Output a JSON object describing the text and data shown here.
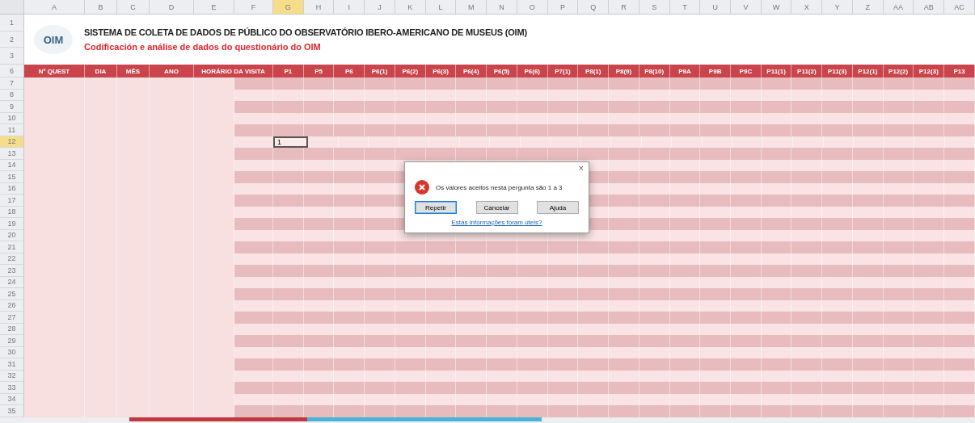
{
  "columns": [
    {
      "letter": "A",
      "selected": false
    },
    {
      "letter": "B",
      "selected": false
    },
    {
      "letter": "C",
      "selected": false
    },
    {
      "letter": "D",
      "selected": false
    },
    {
      "letter": "E",
      "selected": false
    },
    {
      "letter": "F",
      "selected": false
    },
    {
      "letter": "G",
      "selected": true
    },
    {
      "letter": "H",
      "selected": false
    },
    {
      "letter": "I",
      "selected": false
    },
    {
      "letter": "J",
      "selected": false
    },
    {
      "letter": "K",
      "selected": false
    },
    {
      "letter": "L",
      "selected": false
    },
    {
      "letter": "M",
      "selected": false
    },
    {
      "letter": "N",
      "selected": false
    },
    {
      "letter": "O",
      "selected": false
    },
    {
      "letter": "P",
      "selected": false
    },
    {
      "letter": "Q",
      "selected": false
    },
    {
      "letter": "R",
      "selected": false
    },
    {
      "letter": "S",
      "selected": false
    },
    {
      "letter": "T",
      "selected": false
    },
    {
      "letter": "U",
      "selected": false
    },
    {
      "letter": "V",
      "selected": false
    },
    {
      "letter": "W",
      "selected": false
    },
    {
      "letter": "X",
      "selected": false
    },
    {
      "letter": "Y",
      "selected": false
    },
    {
      "letter": "Z",
      "selected": false
    },
    {
      "letter": "AA",
      "selected": false
    },
    {
      "letter": "AB",
      "selected": false
    },
    {
      "letter": "AC",
      "selected": false
    }
  ],
  "title_rows": [
    "1",
    "2",
    "3"
  ],
  "logo": "OIM",
  "title": "SISTEMA DE COLETA DE DADOS DE PÚBLICO DO OBSERVATÓRIO IBERO-AMERICANO DE MUSEUS (OIM)",
  "subtitle": "Codificación e análise de dados do questionário do OIM",
  "header": {
    "row": "6",
    "cells": [
      {
        "label": "Nº QUEST",
        "wide": false
      },
      {
        "label": "DIA",
        "wide": false
      },
      {
        "label": "MÊS",
        "wide": false
      },
      {
        "label": "ANO",
        "wide": false
      },
      {
        "label": "HORÁRIO DA VISITA",
        "wide": true
      },
      {
        "label": "P1",
        "wide": false
      },
      {
        "label": "P5",
        "wide": false
      },
      {
        "label": "P6",
        "wide": false
      },
      {
        "label": "P6(1)",
        "wide": false
      },
      {
        "label": "P6(2)",
        "wide": false
      },
      {
        "label": "P6(3)",
        "wide": false
      },
      {
        "label": "P6(4)",
        "wide": false
      },
      {
        "label": "P6(5)",
        "wide": false
      },
      {
        "label": "P6(6)",
        "wide": false
      },
      {
        "label": "P7(1)",
        "wide": false
      },
      {
        "label": "P8(1)",
        "wide": false
      },
      {
        "label": "P8(9)",
        "wide": false
      },
      {
        "label": "P8(10)",
        "wide": false
      },
      {
        "label": "P9A",
        "wide": false
      },
      {
        "label": "P9B",
        "wide": false
      },
      {
        "label": "P9C",
        "wide": false
      },
      {
        "label": "P11(1)",
        "wide": false
      },
      {
        "label": "P11(2)",
        "wide": false
      },
      {
        "label": "P11(3)",
        "wide": false
      },
      {
        "label": "P12(1)",
        "wide": false
      },
      {
        "label": "P12(2)",
        "wide": false
      },
      {
        "label": "P12(3)",
        "wide": false
      },
      {
        "label": "P13",
        "wide": false
      }
    ]
  },
  "rows": [
    {
      "number": "7",
      "selected": false
    },
    {
      "number": "8",
      "selected": false
    },
    {
      "number": "9",
      "selected": false
    },
    {
      "number": "10",
      "selected": false
    },
    {
      "number": "11",
      "selected": false
    },
    {
      "number": "12",
      "selected": true
    },
    {
      "number": "13",
      "selected": false
    },
    {
      "number": "14",
      "selected": false
    },
    {
      "number": "15",
      "selected": false
    },
    {
      "number": "16",
      "selected": false
    },
    {
      "number": "17",
      "selected": false
    },
    {
      "number": "18",
      "selected": false
    },
    {
      "number": "19",
      "selected": false
    },
    {
      "number": "20",
      "selected": false
    },
    {
      "number": "21",
      "selected": false
    },
    {
      "number": "22",
      "selected": false
    },
    {
      "number": "23",
      "selected": false
    },
    {
      "number": "24",
      "selected": false
    },
    {
      "number": "25",
      "selected": false
    },
    {
      "number": "26",
      "selected": false
    },
    {
      "number": "27",
      "selected": false
    },
    {
      "number": "28",
      "selected": false
    },
    {
      "number": "29",
      "selected": false
    },
    {
      "number": "30",
      "selected": false
    },
    {
      "number": "31",
      "selected": false
    },
    {
      "number": "32",
      "selected": false
    },
    {
      "number": "33",
      "selected": false
    },
    {
      "number": "34",
      "selected": false
    },
    {
      "number": "35",
      "selected": false
    }
  ],
  "active_cell": {
    "value": "1"
  },
  "dialog": {
    "close": "×",
    "message": "Os valores aceitos nesta pergunta são 1 a 3",
    "buttons": [
      {
        "label": "Repetir",
        "selected": true
      },
      {
        "label": "Cancelar",
        "selected": false
      },
      {
        "label": "Ajuda",
        "selected": false
      }
    ],
    "link": "Estas informações foram úteis?"
  },
  "sheet_tabs": [
    {
      "color": "#c0393f"
    },
    {
      "color": "#4ab3d8"
    }
  ]
}
